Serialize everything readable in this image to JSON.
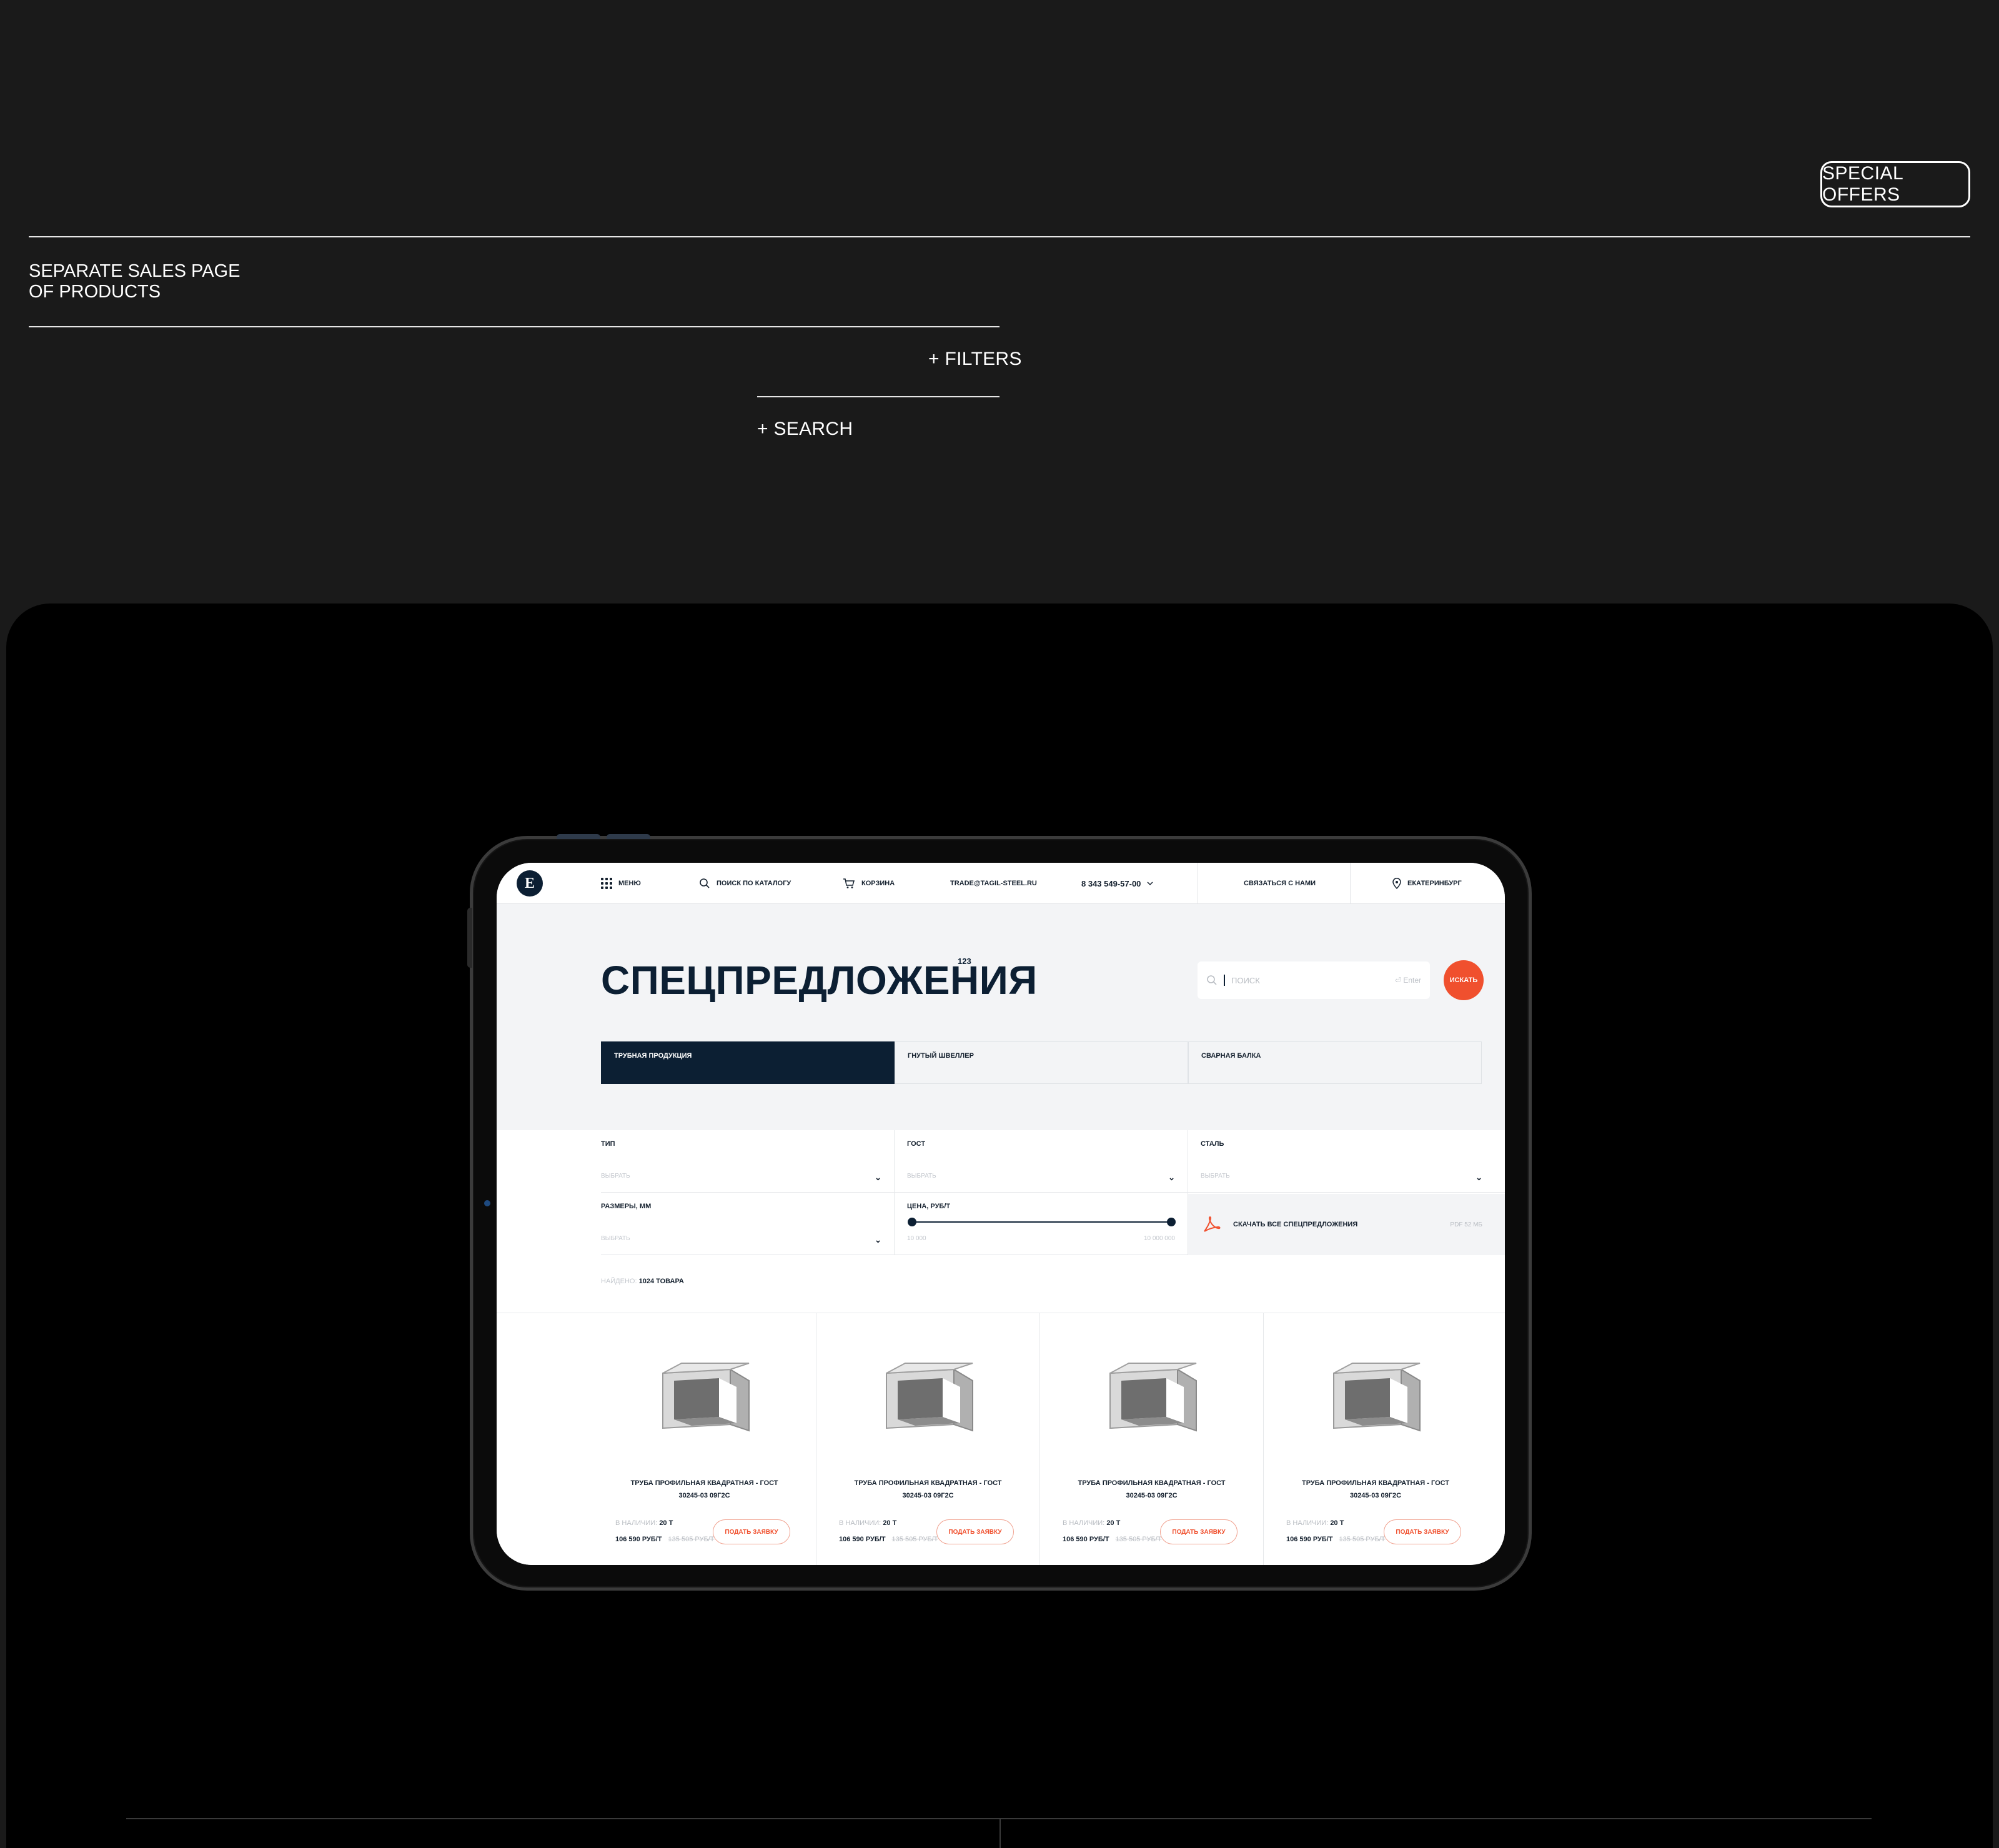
{
  "slide": {
    "special_offers_label": "SPECIAL OFFERS",
    "caption_line1": "SEPARATE SALES PAGE",
    "caption_line2": "OF PRODUCTS",
    "feature_filters": "+ FILTERS",
    "feature_search": "+ SEARCH"
  },
  "header": {
    "menu": "МЕНЮ",
    "catalog_search": "ПОИСК ПО КАТАЛОГУ",
    "cart": "КОРЗИНА",
    "email": "TRADE@TAGIL-STEEL.RU",
    "phone": "8 343 549-57-00",
    "contact": "СВЯЗАТЬСЯ С НАМИ",
    "city": "ЕКАТЕРИНБУРГ"
  },
  "hero": {
    "title": "СПЕЦПРЕДЛОЖЕНИЯ",
    "count": "123",
    "search_placeholder": "ПОИСК",
    "enter_hint": "Enter",
    "search_button": "ИСКАТЬ"
  },
  "tabs": [
    {
      "label": "ТРУБНАЯ ПРОДУКЦИЯ",
      "active": true
    },
    {
      "label": "ГНУТЫЙ ШВЕЛЛЕР",
      "active": false
    },
    {
      "label": "СВАРНАЯ БАЛКА",
      "active": false
    }
  ],
  "filters": {
    "type_label": "ТИП",
    "gost_label": "ГОСТ",
    "steel_label": "СТАЛЬ",
    "sizes_label": "РАЗМЕРЫ, ММ",
    "price_label": "ЦЕНА, РУБ/Т",
    "select_placeholder": "ВЫБРАТЬ",
    "price_min": "10 000",
    "price_max": "10 000 000",
    "price_range_fraction": [
      0,
      1
    ],
    "download_label": "СКАЧАТЬ ВСЕ СПЕЦПРЕДЛОЖЕНИЯ",
    "download_meta": "PDF  52 МБ",
    "found_prefix": "НАЙДЕНО:",
    "found_value": "1024 ТОВАРА"
  },
  "products": [
    {
      "name_line1": "ТРУБА ПРОФИЛЬНАЯ КВАДРАТНАЯ - ГОСТ",
      "name_line2": "30245-03 09Г2С",
      "stock_label": "В НАЛИЧИИ:",
      "stock_value": "20 Т",
      "price": "106 590 РУБ/Т",
      "old_price": "135 505 РУБ/Т",
      "order_label": "ПОДАТЬ ЗАЯВКУ"
    },
    {
      "name_line1": "ТРУБА ПРОФИЛЬНАЯ КВАДРАТНАЯ - ГОСТ",
      "name_line2": "30245-03 09Г2С",
      "stock_label": "В НАЛИЧИИ:",
      "stock_value": "20 Т",
      "price": "106 590 РУБ/Т",
      "old_price": "135 505 РУБ/Т",
      "order_label": "ПОДАТЬ ЗАЯВКУ"
    },
    {
      "name_line1": "ТРУБА ПРОФИЛЬНАЯ КВАДРАТНАЯ - ГОСТ",
      "name_line2": "30245-03 09Г2С",
      "stock_label": "В НАЛИЧИИ:",
      "stock_value": "20 Т",
      "price": "106 590 РУБ/Т",
      "old_price": "135 505 РУБ/Т",
      "order_label": "ПОДАТЬ ЗАЯВКУ"
    },
    {
      "name_line1": "ТРУБА ПРОФИЛЬНАЯ КВАДРАТНАЯ - ГОСТ",
      "name_line2": "30245-03 09Г2С",
      "stock_label": "В НАЛИЧИИ:",
      "stock_value": "20 Т",
      "price": "106 590 РУБ/Т",
      "old_price": "135 505 РУБ/Т",
      "order_label": "ПОДАТЬ ЗАЯВКУ"
    }
  ],
  "icons": {
    "menu": "grid-icon",
    "search": "search-icon",
    "cart": "cart-icon",
    "phone_dropdown": "chevron-down-icon",
    "city": "location-pin-icon",
    "pdf": "pdf-icon",
    "logo": "tagil-steel-logo"
  },
  "colors": {
    "background": "#1a1a1a",
    "stage": "#000000",
    "navy": "#0c1f33",
    "accent": "#f0502e"
  }
}
